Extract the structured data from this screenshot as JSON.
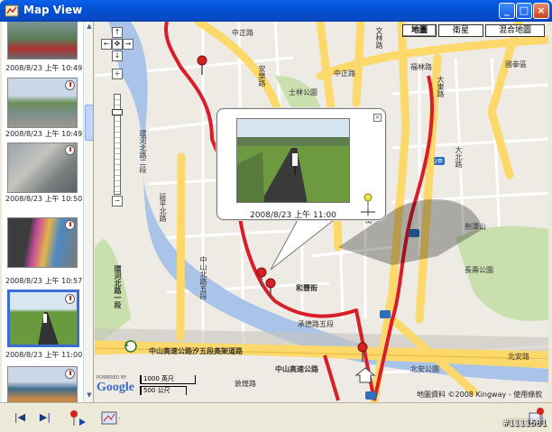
{
  "window": {
    "title": "Map View",
    "minimize_glyph": "_",
    "maximize_glyph": "□",
    "close_glyph": "×"
  },
  "sidebar": {
    "items": [
      {
        "time": "2008/8/23 上午 10:49"
      },
      {
        "time": "2008/8/23 上午 10:49"
      },
      {
        "time": "2008/8/23 上午 10:50"
      },
      {
        "time": "2008/8/23 上午 10:57"
      },
      {
        "time": "2008/8/23 上午 11:00"
      },
      {
        "time": ""
      }
    ],
    "selected_index": 4
  },
  "map": {
    "type_buttons": [
      "地圖",
      "衛星",
      "混合地圖"
    ],
    "active_type": "地圖",
    "zoom_level_fraction": 0.85,
    "labels": {
      "zhongshan_hwy": "中山高速公路汐五段高架道路",
      "zhongshan_hwy2": "中山高速公路",
      "dunhuang": "敦煌路",
      "zhongzheng": "中正路",
      "wenlin": "文林路",
      "fulin": "福林路",
      "dabei": "大北路",
      "shilin_park": "士林公園",
      "anle": "安樂路",
      "dadong": "大東路",
      "chengde5": "承德路五段",
      "tongshan": "同山街",
      "heli": "和豐街",
      "jiantan": "劍潭山",
      "changshou_park": "長壽公園",
      "guoanxiaoqu": "國拳區",
      "zhongzheng_park": "中正路",
      "beian": "北安路",
      "gongyuan": "北安公園",
      "yanping": "延平北路",
      "jinyuan": "中山北路五段",
      "section2": "堤頂大道",
      "fuji": "自強隧道",
      "dike": "環河北路一段",
      "huanhe": "環河北路二段"
    },
    "copyright": "地圖資料 ©2008 Kingway - 使用條款",
    "powered_by": "POWERED BY",
    "google": "Google",
    "scale_ft": "1000 英尺",
    "scale_m": "500 公尺",
    "hwy_shield": "1",
    "route_shield": "2甲"
  },
  "info_window": {
    "caption": "2008/8/23 上午 11:00",
    "close_glyph": "×"
  },
  "toolbar": {
    "first": "|◀",
    "last": "▶|"
  },
  "watermark": "#1111581",
  "colors": {
    "route": "#d91e2a",
    "major_road": "#fdd86a",
    "river": "#a9c4e8",
    "park": "#c9dfae",
    "block": "#eeeae4"
  }
}
